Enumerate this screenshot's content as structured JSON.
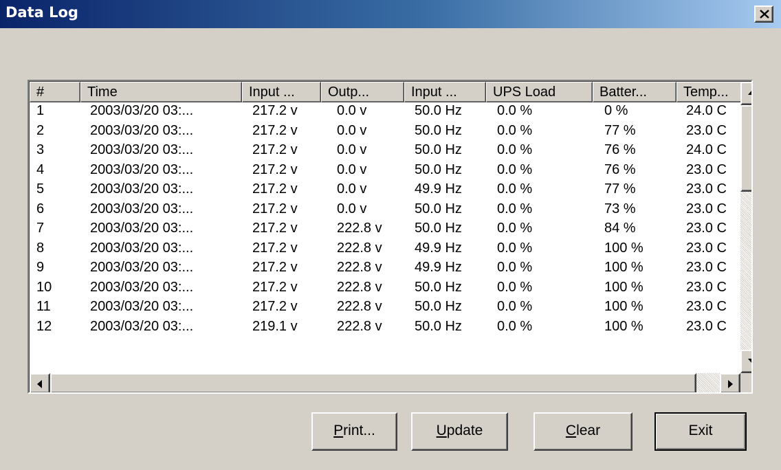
{
  "window": {
    "title": "Data Log",
    "close_glyph": "✕"
  },
  "columns": [
    "#",
    "Time",
    "Input ...",
    "Outp...",
    "Input ...",
    "UPS Load",
    "Batter...",
    "Temp..."
  ],
  "rows": [
    [
      "1",
      "2003/03/20 03:...",
      "217.2 v",
      "0.0 v",
      "50.0 Hz",
      "0.0 %",
      "0 %",
      "24.0 C"
    ],
    [
      "2",
      "2003/03/20 03:...",
      "217.2 v",
      "0.0 v",
      "50.0 Hz",
      "0.0 %",
      "77 %",
      "23.0 C"
    ],
    [
      "3",
      "2003/03/20 03:...",
      "217.2 v",
      "0.0 v",
      "50.0 Hz",
      "0.0 %",
      "76 %",
      "24.0 C"
    ],
    [
      "4",
      "2003/03/20 03:...",
      "217.2 v",
      "0.0 v",
      "50.0 Hz",
      "0.0 %",
      "76 %",
      "23.0 C"
    ],
    [
      "5",
      "2003/03/20 03:...",
      "217.2 v",
      "0.0 v",
      "49.9 Hz",
      "0.0 %",
      "77 %",
      "23.0 C"
    ],
    [
      "6",
      "2003/03/20 03:...",
      "217.2 v",
      "0.0 v",
      "50.0 Hz",
      "0.0 %",
      "73 %",
      "23.0 C"
    ],
    [
      "7",
      "2003/03/20 03:...",
      "217.2 v",
      "222.8 v",
      "50.0 Hz",
      "0.0 %",
      "84 %",
      "23.0 C"
    ],
    [
      "8",
      "2003/03/20 03:...",
      "217.2 v",
      "222.8 v",
      "49.9 Hz",
      "0.0 %",
      "100 %",
      "23.0 C"
    ],
    [
      "9",
      "2003/03/20 03:...",
      "217.2 v",
      "222.8 v",
      "49.9 Hz",
      "0.0 %",
      "100 %",
      "23.0 C"
    ],
    [
      "10",
      "2003/03/20 03:...",
      "217.2 v",
      "222.8 v",
      "50.0 Hz",
      "0.0 %",
      "100 %",
      "23.0 C"
    ],
    [
      "11",
      "2003/03/20 03:...",
      "217.2 v",
      "222.8 v",
      "50.0 Hz",
      "0.0 %",
      "100 %",
      "23.0 C"
    ],
    [
      "12",
      "2003/03/20 03:...",
      "219.1 v",
      "222.8 v",
      "50.0 Hz",
      "0.0 %",
      "100 %",
      "23.0 C"
    ]
  ],
  "buttons": {
    "print": {
      "mnemonic": "P",
      "rest": "rint..."
    },
    "update": {
      "mnemonic": "U",
      "rest": "pdate"
    },
    "clear": {
      "mnemonic": "C",
      "rest": "lear"
    },
    "exit": {
      "label": "Exit"
    }
  },
  "colors": {
    "titlebar_start": "#0a246a",
    "titlebar_end": "#a6caf0",
    "face": "#d4d0c8"
  }
}
